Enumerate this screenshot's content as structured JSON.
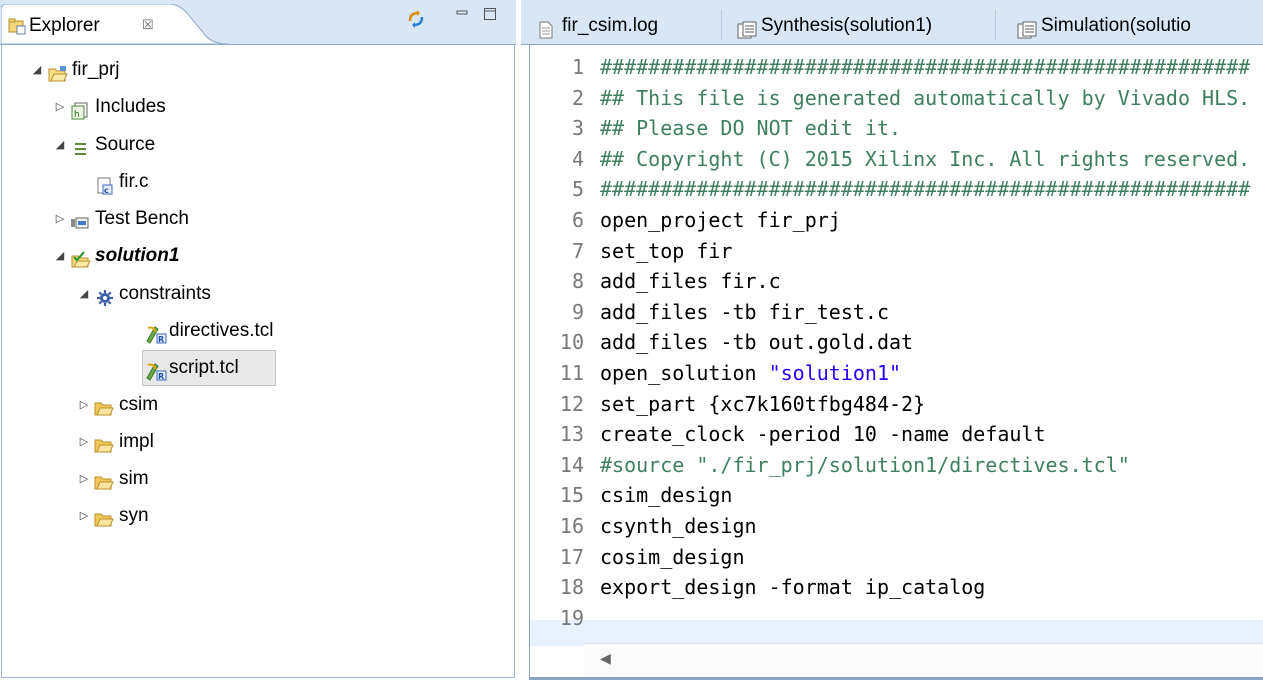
{
  "explorer": {
    "tab_title": "Explorer",
    "close_glyph": "☒",
    "tree": [
      {
        "label": "fir_prj",
        "icon": "project-folder-icon",
        "toggle": "expanded"
      },
      {
        "label": "Includes",
        "icon": "includes-icon",
        "toggle": "collapsed"
      },
      {
        "label": "Source",
        "icon": "source-icon",
        "toggle": "expanded"
      },
      {
        "label": "fir.c",
        "icon": "c-file-icon",
        "toggle": "none"
      },
      {
        "label": "Test Bench",
        "icon": "test-bench-icon",
        "toggle": "collapsed"
      },
      {
        "label": "solution1",
        "icon": "solution-folder-icon",
        "toggle": "expanded"
      },
      {
        "label": "constraints",
        "icon": "constraints-gear-icon",
        "toggle": "expanded"
      },
      {
        "label": "directives.tcl",
        "icon": "tcl-file-icon",
        "toggle": "none"
      },
      {
        "label": "script.tcl",
        "icon": "tcl-file-icon",
        "toggle": "none",
        "selected": true
      },
      {
        "label": "csim",
        "icon": "folder-icon",
        "toggle": "collapsed"
      },
      {
        "label": "impl",
        "icon": "folder-icon",
        "toggle": "collapsed"
      },
      {
        "label": "sim",
        "icon": "folder-icon",
        "toggle": "collapsed"
      },
      {
        "label": "syn",
        "icon": "folder-icon",
        "toggle": "collapsed"
      }
    ]
  },
  "editor": {
    "tabs": [
      {
        "label": "fir_csim.log",
        "icon": "log-file-icon"
      },
      {
        "label": "Synthesis(solution1)",
        "icon": "report-icon"
      },
      {
        "label": "Simulation(solutio",
        "icon": "report-icon"
      }
    ],
    "lines": [
      {
        "n": "1",
        "text": "######################################################",
        "kind": "comment"
      },
      {
        "n": "2",
        "text": "## This file is generated automatically by Vivado HLS.",
        "kind": "comment"
      },
      {
        "n": "3",
        "text": "## Please DO NOT edit it.",
        "kind": "comment"
      },
      {
        "n": "4",
        "text": "## Copyright (C) 2015 Xilinx Inc. All rights reserved.",
        "kind": "comment"
      },
      {
        "n": "5",
        "text": "######################################################",
        "kind": "comment"
      },
      {
        "n": "6",
        "text": "open_project fir_prj",
        "kind": "code"
      },
      {
        "n": "7",
        "text": "set_top fir",
        "kind": "code"
      },
      {
        "n": "8",
        "text": "add_files fir.c",
        "kind": "code"
      },
      {
        "n": "9",
        "text": "add_files -tb fir_test.c",
        "kind": "code"
      },
      {
        "n": "10",
        "text": "add_files -tb out.gold.dat",
        "kind": "code"
      },
      {
        "n": "11",
        "pre": "open_solution ",
        "str": "\"solution1\"",
        "kind": "string"
      },
      {
        "n": "12",
        "text": "set_part {xc7k160tfbg484-2}",
        "kind": "code"
      },
      {
        "n": "13",
        "text": "create_clock -period 10 -name default",
        "kind": "code"
      },
      {
        "n": "14",
        "text": "#source \"./fir_prj/solution1/directives.tcl\"",
        "kind": "commentline"
      },
      {
        "n": "15",
        "text": "csim_design",
        "kind": "code"
      },
      {
        "n": "16",
        "text": "csynth_design",
        "kind": "code"
      },
      {
        "n": "17",
        "text": "cosim_design",
        "kind": "code"
      },
      {
        "n": "18",
        "text": "export_design -format ip_catalog",
        "kind": "code"
      },
      {
        "n": "19",
        "text": "",
        "kind": "code"
      }
    ]
  }
}
